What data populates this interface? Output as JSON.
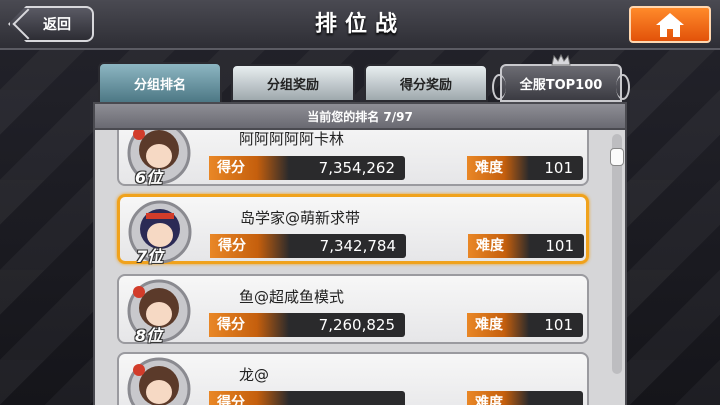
{
  "header": {
    "title": "排位战",
    "back_label": "返回"
  },
  "tabs": [
    {
      "label": "分组排名",
      "active": true
    },
    {
      "label": "分组奖励",
      "active": false
    },
    {
      "label": "得分奖励",
      "active": false
    },
    {
      "label": "全服TOP100",
      "active": false
    }
  ],
  "panel": {
    "current_rank_text": "当前您的排名 7/97"
  },
  "rows": [
    {
      "rank": "6位",
      "name": "阿阿阿阿阿卡林",
      "score_label": "得分",
      "score": "7,354,262",
      "difficulty_label": "难度",
      "difficulty": "101",
      "highlight": false
    },
    {
      "rank": "7位",
      "name": "岛学家@萌新求带",
      "score_label": "得分",
      "score": "7,342,784",
      "difficulty_label": "难度",
      "difficulty": "101",
      "highlight": true
    },
    {
      "rank": "8位",
      "name": "鱼@超咸鱼模式",
      "score_label": "得分",
      "score": "7,260,825",
      "difficulty_label": "难度",
      "difficulty": "101",
      "highlight": false
    },
    {
      "rank": "",
      "name": "龙@",
      "score_label": "得分",
      "score": "",
      "difficulty_label": "难度",
      "difficulty": "",
      "highlight": false
    }
  ],
  "colors": {
    "accent_orange": "#e98726",
    "highlight_border": "#f0a21c",
    "home_button": "#f06a12"
  },
  "icons": {
    "home": "home-icon",
    "back": "back-arrow-icon",
    "crown": "crown-icon"
  }
}
